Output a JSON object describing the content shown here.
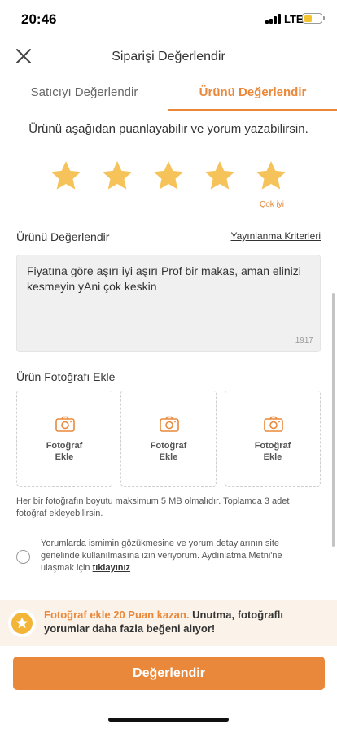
{
  "status_bar": {
    "time": "20:46",
    "network": "LTE",
    "battery_level": 0.45,
    "icons": [
      "signal-icon",
      "battery-icon"
    ]
  },
  "header": {
    "title": "Siparişi Değerlendir",
    "close_icon": "close-icon"
  },
  "tabs": [
    {
      "label": "Satıcıyı Değerlendir",
      "active": false
    },
    {
      "label": "Ürünü Değerlendir",
      "active": true
    }
  ],
  "intro": "Ürünü aşağıdan puanlayabilir ve yorum yazabilirsin.",
  "rating": {
    "value": 5,
    "max": 5,
    "label": "Çok iyi"
  },
  "review": {
    "section_title": "Ürünü Değerlendir",
    "criteria_link": "Yayınlanma Kriterleri",
    "text": "Fiyatına göre aşırı iyi aşırı Prof bir makas, aman elinizi kesmeyin yAni çok keskin",
    "char_count": "1917"
  },
  "photos": {
    "section_title": "Ürün Fotoğrafı Ekle",
    "slot_label_line1": "Fotoğraf",
    "slot_label_line2": "Ekle",
    "note": "Her bir fotoğrafın boyutu maksimum 5 MB olmalıdır. Toplamda 3 adet fotoğraf ekleyebilirsin."
  },
  "consent": {
    "text": "Yorumlarda ismimin gözükmesine ve yorum detaylarının site genelinde kullanılmasına izin veriyorum. Aydınlatma Metni'ne ulaşmak için",
    "link": "tıklayınız",
    "checked": false
  },
  "promo": {
    "highlight": "Fotoğraf ekle 20 Puan kazan.",
    "text": "Unutma, fotoğraflı yorumlar daha fazla beğeni alıyor!"
  },
  "submit_label": "Değerlendir",
  "colors": {
    "accent": "#e9883a",
    "star": "#f5c35a",
    "promo_bg": "#fbf3ea",
    "input_bg": "#f0f0f0"
  }
}
